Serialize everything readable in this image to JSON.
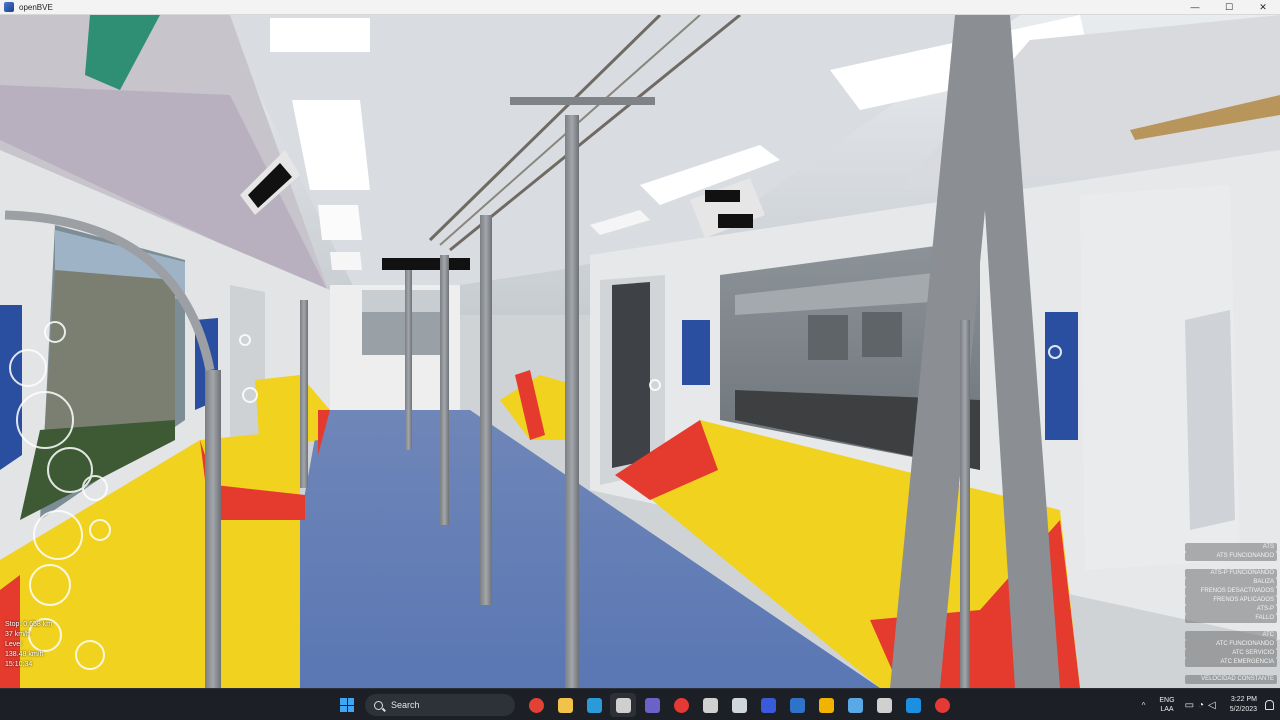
{
  "window": {
    "title": "openBVE",
    "controls": [
      "—",
      "☐",
      "✕"
    ]
  },
  "hud_left": {
    "lines": [
      "Stop: 0.658 km",
      "37 km/h",
      "Level",
      "138.48 km/h",
      "15:10:34"
    ]
  },
  "hud_right": {
    "indicators": [
      "ATS",
      "ATS FUNCIONANDO",
      "",
      "ATS-P FUNCIONANDO",
      "BALIZA",
      "FRENOS DESACTIVADOS",
      "FRENOS APLICADOS",
      "ATS-P",
      "FALLO",
      "",
      "ATC",
      "ATC FUNCIONANDO",
      "ATC SERVICIO",
      "ATC EMERGENCIA",
      "",
      "VELOCIDAD CONSTANTE"
    ]
  },
  "taskbar": {
    "search_label": "Search",
    "apps": [
      {
        "name": "chrome-icon",
        "color": "#e34133"
      },
      {
        "name": "file-explorer-icon",
        "color": "#f3c24a"
      },
      {
        "name": "edge-icon",
        "color": "#2a9bd8"
      },
      {
        "name": "openbve-icon",
        "color": "#cfcfcf"
      },
      {
        "name": "teams-icon",
        "color": "#6b62c7"
      },
      {
        "name": "record-icon",
        "color": "#e53935"
      },
      {
        "name": "camera-icon",
        "color": "#d0d0d0"
      },
      {
        "name": "shield-icon",
        "color": "#cfd6de"
      },
      {
        "name": "display-icon",
        "color": "#3a5bd9"
      },
      {
        "name": "visio-icon",
        "color": "#2f73c9"
      },
      {
        "name": "folder-icon",
        "color": "#f0b400"
      },
      {
        "name": "notepad-icon",
        "color": "#5aa9e6"
      },
      {
        "name": "app-icon",
        "color": "#d0d0d0"
      },
      {
        "name": "window-icon",
        "color": "#1d8fe0"
      },
      {
        "name": "obs-icon",
        "color": "#e53935"
      }
    ],
    "tray": {
      "chevron": "^",
      "lang_top": "ENG",
      "lang_bottom": "LAA",
      "time": "3:22 PM",
      "date": "5/2/2023"
    }
  }
}
